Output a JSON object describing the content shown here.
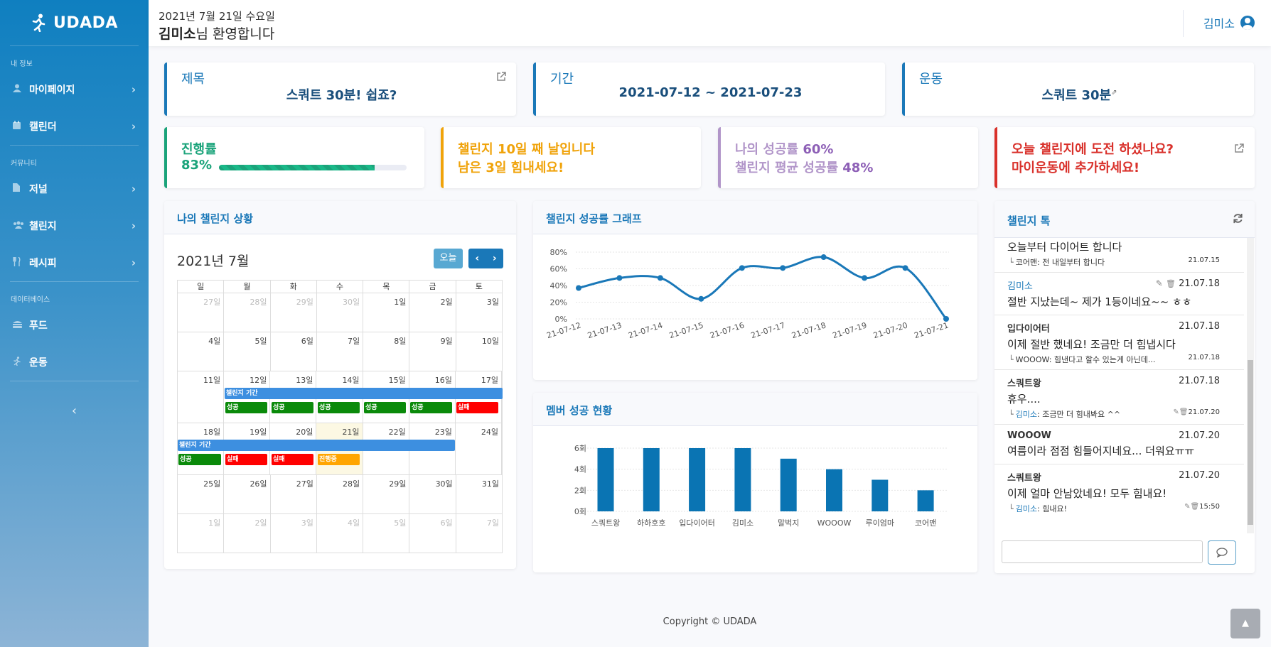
{
  "brand": {
    "name": "UDADA",
    "logo_icon": "runner-icon"
  },
  "sidebar": {
    "sections": [
      {
        "heading": "내 정보",
        "items": [
          {
            "label": "마이페이지",
            "icon": "user-icon"
          },
          {
            "label": "캘린더",
            "icon": "calendar-icon"
          }
        ]
      },
      {
        "heading": "커뮤니티",
        "items": [
          {
            "label": "저널",
            "icon": "file-icon"
          },
          {
            "label": "챌린지",
            "icon": "users-icon"
          },
          {
            "label": "레시피",
            "icon": "utensils-icon"
          }
        ]
      },
      {
        "heading": "데이터베이스",
        "items": [
          {
            "label": "푸드",
            "icon": "hamburger-icon"
          },
          {
            "label": "운동",
            "icon": "running-icon"
          }
        ]
      }
    ],
    "toggle": "‹"
  },
  "topbar": {
    "date": "2021년 7월 21일 수요일",
    "user_name_bold": "김미소",
    "welcome_suffix": "님 환영합니다",
    "user": "김미소"
  },
  "info_cards": [
    {
      "title": "제목",
      "value": "스쿼트 30분! 쉽죠?"
    },
    {
      "title": "기간",
      "value": "2021-07-12 ~ 2021-07-23"
    },
    {
      "title": "운동",
      "value": "스쿼트 30분"
    }
  ],
  "stats": {
    "progress": {
      "label": "진행률",
      "value": "83%",
      "fraction": 0.83,
      "color": "#1aa37a"
    },
    "days": {
      "line1": "챌린지 10일 째 날입니다",
      "line2": "남은 3일 힘내세요!",
      "color": "#f0a30a"
    },
    "rate": {
      "line1_prefix": "나의 성공률 ",
      "line1_value": "60%",
      "line2_prefix": "챌린지 평균 성공률 ",
      "line2_value": "48%",
      "color": "#b195c9",
      "value_color": "#8d5fb6"
    },
    "cta": {
      "line1": "오늘 챌린지에 도전 하셨나요?",
      "line2": "마이운동에 추가하세요!",
      "color": "#d9312b"
    }
  },
  "calendar": {
    "panel_title": "나의 챌린지 상황",
    "month_title": "2021년 7월",
    "today_button": "오늘",
    "prev": "‹",
    "next": "›",
    "weekdays": [
      "일",
      "월",
      "화",
      "수",
      "목",
      "금",
      "토"
    ],
    "weeks": [
      [
        "27일",
        "28일",
        "29일",
        "30일",
        "1일",
        "2일",
        "3일"
      ],
      [
        "4일",
        "5일",
        "6일",
        "7일",
        "8일",
        "9일",
        "10일"
      ],
      [
        "11일",
        "12일",
        "13일",
        "14일",
        "15일",
        "16일",
        "17일"
      ],
      [
        "18일",
        "19일",
        "20일",
        "21일",
        "22일",
        "23일",
        "24일"
      ],
      [
        "25일",
        "26일",
        "27일",
        "28일",
        "29일",
        "30일",
        "31일"
      ],
      [
        "1일",
        "2일",
        "3일",
        "4일",
        "5일",
        "6일",
        "7일"
      ]
    ],
    "period_label": "챌린지 기간",
    "week3_tags": [
      "성공",
      "성공",
      "성공",
      "성공",
      "성공",
      "실패"
    ],
    "week4_tags": [
      "성공",
      "실패",
      "실패",
      "진행중"
    ]
  },
  "rate_chart": {
    "title": "챌린지 성공률 그래프"
  },
  "member_chart": {
    "title": "멤버 성공 현황"
  },
  "chart_data": [
    {
      "type": "line",
      "title": "챌린지 성공률 그래프",
      "x": [
        "21-07-12",
        "21-07-13",
        "21-07-14",
        "21-07-15",
        "21-07-16",
        "21-07-17",
        "21-07-18",
        "21-07-19",
        "21-07-20",
        "21-07-21"
      ],
      "y_ticks": [
        "0%",
        "20%",
        "40%",
        "60%",
        "80%"
      ],
      "ylim": [
        0,
        80
      ],
      "series": [
        {
          "values": [
            37,
            49,
            49,
            24,
            61,
            61,
            74,
            49,
            61,
            0
          ],
          "color": "#1a78b8"
        }
      ],
      "grid": true
    },
    {
      "type": "bar",
      "title": "멤버 성공 현황",
      "categories": [
        "스쿼트왕",
        "하하호호",
        "입다이어터",
        "김미소",
        "말벅지",
        "WOOOW",
        "루이엄마",
        "코어맨"
      ],
      "values": [
        6,
        6,
        6,
        6,
        5,
        4,
        3,
        2
      ],
      "y_ticks": [
        "0회",
        "2회",
        "4회",
        "6회"
      ],
      "ylim": [
        0,
        6
      ],
      "color": "#0a74b3",
      "grid": true
    }
  ],
  "chat": {
    "title": "챌린지 톡",
    "messages": [
      {
        "author": "",
        "time": "",
        "text": "오늘부터 다이어트 합니다",
        "reply_name": "코어맨",
        "reply_text": ": 전 내일부터 합니다",
        "reply_time": "21.07.15"
      },
      {
        "author": "김미소",
        "time": "21.07.18",
        "text": "절반 지났는데~ 제가 1등이네요~~ ㅎㅎ",
        "me": true
      },
      {
        "author": "입다이어터",
        "time": "21.07.18",
        "text": "이제 절반 했네요! 조금만 더 힘냅시다",
        "reply_name": "WOOOW",
        "reply_text": ": 힘낸다고 할수 있는게 아닌데...",
        "reply_time": "21.07.18"
      },
      {
        "author": "스쿼트왕",
        "time": "21.07.18",
        "text": "휴우....",
        "reply_name": "김미소",
        "reply_text": ": 조금만 더 힘내봐요 ^^",
        "reply_time": "21.07.20",
        "reply_me": true
      },
      {
        "author": "WOOOW",
        "time": "21.07.20",
        "text": "여름이라 점점 힘들어지네요... 더워요ㅠㅠ"
      },
      {
        "author": "스쿼트왕",
        "time": "21.07.20",
        "text": "이제 얼마 안남았네요! 모두 힘내요!",
        "reply_name": "김미소",
        "reply_text": ": 힘내요!",
        "reply_time": "15:50",
        "reply_me": true
      }
    ],
    "input_placeholder": ""
  },
  "footer": "Copyright © UDADA"
}
